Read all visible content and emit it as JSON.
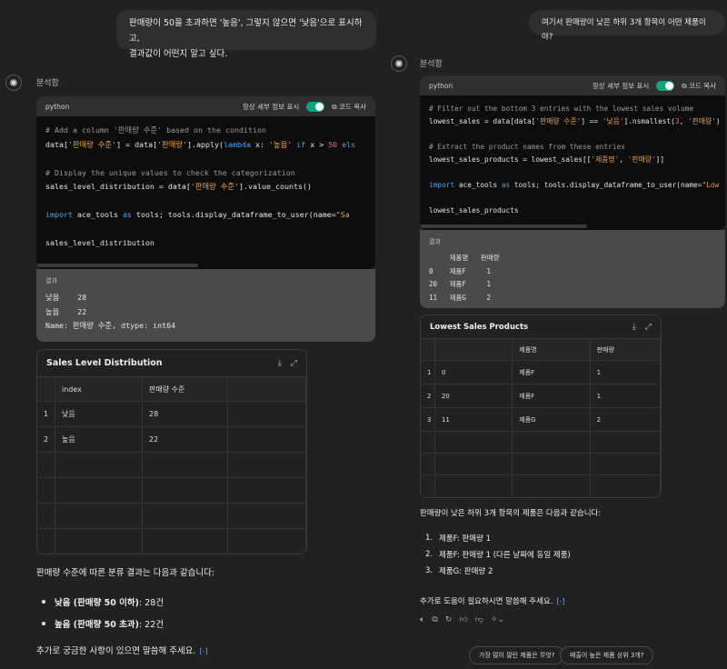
{
  "left": {
    "user_message_line1": "판매량이 50을 초과하면 '높음', 그렇지 않으면 '낮음'으로 표시하고,",
    "user_message_line2": "결과값이 어떤지 알고 싶다.",
    "analysis_label": "분석함",
    "code_header": {
      "language": "python",
      "show_details": "항상 세부 정보 표시",
      "copy": "코드 복사"
    },
    "result_label": "결과",
    "result_lines": [
      "낮음    28",
      "높음    22",
      "Name: 판매량 수준, dtype: int64"
    ],
    "table": {
      "title": "Sales Level Distribution",
      "columns": [
        "",
        "index",
        "판매량 수준"
      ],
      "rows": [
        [
          "1",
          "낮음",
          "28"
        ],
        [
          "2",
          "높음",
          "22"
        ]
      ]
    },
    "summary_intro": "판매량 수준에 따른 분류 결과는 다음과 같습니다:",
    "bullets": [
      {
        "bold": "낮음 (판매량 50 이하)",
        "rest": ": 28건"
      },
      {
        "bold": "높음 (판매량 50 초과)",
        "rest": ": 22건"
      }
    ],
    "closing": "추가로 궁금한 사항이 있으면 말씀해 주세요.",
    "source_icon": "[-]"
  },
  "right": {
    "user_message": "여기서 판매량이 낮은 하위 3개 항목이 어떤 제품이야?",
    "analysis_label": "분석함",
    "code_header": {
      "language": "python",
      "show_details": "항상 세부 정보 표시",
      "copy": "코드 복사"
    },
    "result_label": "결과",
    "result_lines": [
      "     제품명   판매량",
      "0    제품F     1",
      "20   제품F     1",
      "11   제품G     2"
    ],
    "table": {
      "title": "Lowest Sales Products",
      "columns": [
        "",
        "",
        "제품명",
        "판매량"
      ],
      "rows": [
        [
          "1",
          "0",
          "제품F",
          "1"
        ],
        [
          "2",
          "20",
          "제품F",
          "1"
        ],
        [
          "3",
          "11",
          "제품G",
          "2"
        ]
      ]
    },
    "summary_intro": "판매량이 낮은 하위 3개 항목의 제품은 다음과 같습니다:",
    "list": [
      "제품F: 판매량 1",
      "제품F: 판매량 1 (다른 날짜에 동일 제품)",
      "제품G: 판매량 2"
    ],
    "closing": "추가로 도움이 필요하시면 말씀해 주세요.",
    "source_icon": "[-]",
    "suggestions": [
      "가장 많이 팔린 제품은 무엇?",
      "매출이 높은 제품 상위 3개?"
    ]
  }
}
